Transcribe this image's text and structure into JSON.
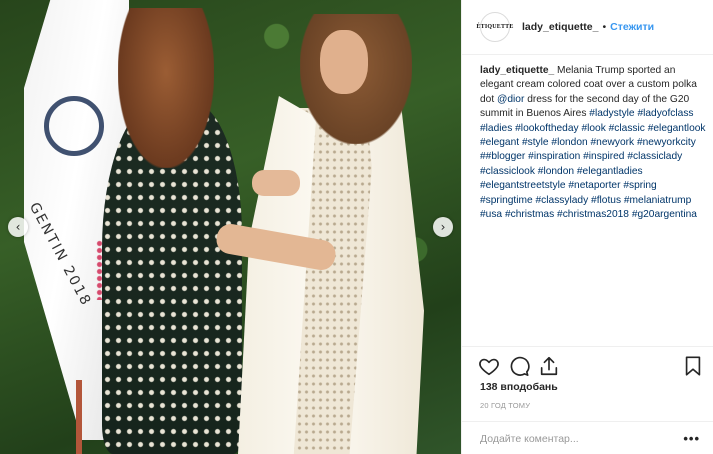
{
  "post": {
    "photo": {
      "alt": "",
      "flag_text": "GENTIN 2018",
      "nav_prev_icon": "chevron-left-icon",
      "nav_next_icon": "chevron-right-icon"
    },
    "header": {
      "avatar_text": "ÉTIQUETTE",
      "username": "lady_etiquette_",
      "separator": "•",
      "follow_label": "Стежити"
    },
    "caption": {
      "username": "lady_etiquette_",
      "text": "Melania Trump sported an elegant cream colored coat over a custom polka dot",
      "mention": "@dior",
      "text2": "dress for the second day of the G20 summit in Buenos Aires",
      "hashtags": [
        "#ladystyle",
        "#ladyofclass",
        "#ladies",
        "#lookoftheday",
        "#look",
        "#classic",
        "#elegantlook",
        "#elegant",
        "#style",
        "#london",
        "#newyork",
        "#newyorkcity",
        "##blogger",
        "#inspiration",
        "#inspired",
        "#classiclady",
        "#classiclook",
        "#london",
        "#elegantladies",
        "#elegantstreetstyle",
        "#netaporter",
        "#spring",
        "#springtime",
        "#classylady",
        "#flotus",
        "#melaniatrump",
        "#usa",
        "#christmas",
        "#christmas2018",
        "#g20argentina"
      ]
    },
    "actions": {
      "icons": [
        "heart-icon",
        "comment-icon",
        "share-icon",
        "bookmark-icon"
      ],
      "likes": "138 вподобань",
      "time": "20 ГОД ТОМУ",
      "comment_placeholder": "Додайте коментар...",
      "more_label": "•••"
    }
  }
}
